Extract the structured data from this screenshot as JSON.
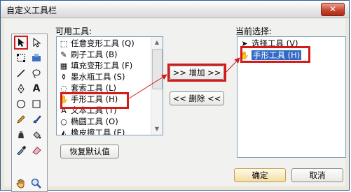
{
  "window": {
    "title": "自定义工具栏",
    "close": "✕"
  },
  "palette": {
    "tools": [
      "arrow-icon",
      "subselect-icon",
      "free-transform-icon",
      "gradient-icon",
      "line-icon",
      "lasso-icon",
      "pen-icon",
      "text-icon",
      "oval-icon",
      "rectangle-icon",
      "pencil-icon",
      "brush-icon",
      "ink-bottle-icon",
      "paint-bucket-icon",
      "eyedropper-icon",
      "eraser-icon",
      "hand-icon",
      "zoom-icon"
    ]
  },
  "available": {
    "label": "可用工具:",
    "items": [
      {
        "label": "任意变形工具 (Q)",
        "icon": "⬚"
      },
      {
        "label": "刷子工具 (B)",
        "icon": "✎"
      },
      {
        "label": "填充变形工具 (F)",
        "icon": "▦"
      },
      {
        "label": "墨水瓶工具 (S)",
        "icon": "⚱"
      },
      {
        "label": "套索工具 (L)",
        "icon": "◌"
      },
      {
        "label": "手形工具 (H)",
        "icon": "✋"
      },
      {
        "label": "文本工具 (T)",
        "icon": "A"
      },
      {
        "label": "椭圆工具 (O)",
        "icon": "○"
      },
      {
        "label": "橡皮擦工具 (E)",
        "icon": "◭"
      }
    ]
  },
  "current": {
    "label": "当前选择:",
    "items": [
      {
        "label": "选择工具 (V)"
      },
      {
        "label": "手形工具 (H)"
      }
    ]
  },
  "buttons": {
    "add": ">> 增加 >>",
    "remove": "<< 删除 <<",
    "restore": "恢复默认值",
    "ok": "确定",
    "cancel": "取消"
  }
}
